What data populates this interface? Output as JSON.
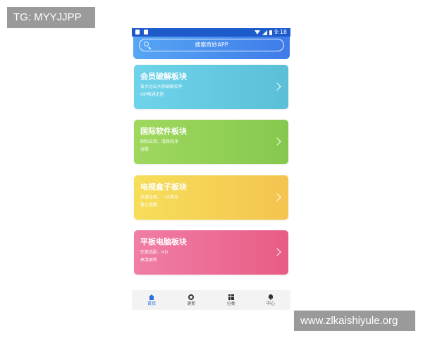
{
  "watermarks": {
    "top": "TG: MYYJJPP",
    "bottom": "www.zlkaishiyule.org"
  },
  "status_bar": {
    "time": "9:18",
    "color": "#1d5bcb"
  },
  "search": {
    "placeholder": "搜索奇妙APP",
    "icon": "search-icon"
  },
  "cards": [
    {
      "title": "会员破解板块",
      "desc1": "各大论坛大神破解软件",
      "desc2": "VIP畅通无阻",
      "color": "#6fd3ea"
    },
    {
      "title": "国际软件板块",
      "desc1": "国际应用，清爽纯净",
      "desc2": "谷歌",
      "color": "#a0d85e"
    },
    {
      "title": "电视盒子板块",
      "desc1": "资源全面，一应俱全",
      "desc2": "警示提醒",
      "color": "#f6de5a"
    },
    {
      "title": "平板电脑板块",
      "desc1": "完美适配，HD",
      "desc2": "高清更新",
      "color": "#f07ea6"
    }
  ],
  "tabs": [
    {
      "label": "首页",
      "icon": "home-icon",
      "active": true
    },
    {
      "label": "更新",
      "icon": "update-icon",
      "active": false
    },
    {
      "label": "分类",
      "icon": "grid-icon",
      "active": false
    },
    {
      "label": "中心",
      "icon": "bell-icon",
      "active": false
    }
  ],
  "colors": {
    "accent": "#2a6fdb",
    "header_from": "#57a6f5",
    "header_to": "#3e7be9"
  }
}
